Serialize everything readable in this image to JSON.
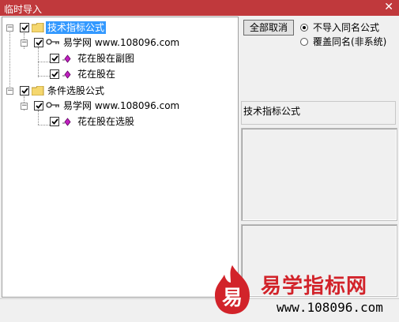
{
  "window": {
    "title": "临时导入",
    "close_glyph": "✕"
  },
  "tree": {
    "groups": [
      {
        "label": "技术指标公式",
        "selected": true,
        "source": "易学网 www.108096.com",
        "items": [
          "花在股在副图",
          "花在股在"
        ]
      },
      {
        "label": "条件选股公式",
        "selected": false,
        "source": "易学网 www.108096.com",
        "items": [
          "花在股在选股"
        ]
      }
    ]
  },
  "actions": {
    "deselect_all": "全部取消"
  },
  "options": [
    {
      "label": "不导入同名公式",
      "checked": true
    },
    {
      "label": "覆盖同名(非系统)",
      "checked": false
    }
  ],
  "info": {
    "type_label": "技术指标公式"
  },
  "watermark": {
    "title": "易学指标网",
    "url": "www.108096.com",
    "logo_char": "易"
  },
  "colors": {
    "titlebar": "#c0393c",
    "selection": "#3399ff",
    "watermark_red": "#d2232a"
  }
}
